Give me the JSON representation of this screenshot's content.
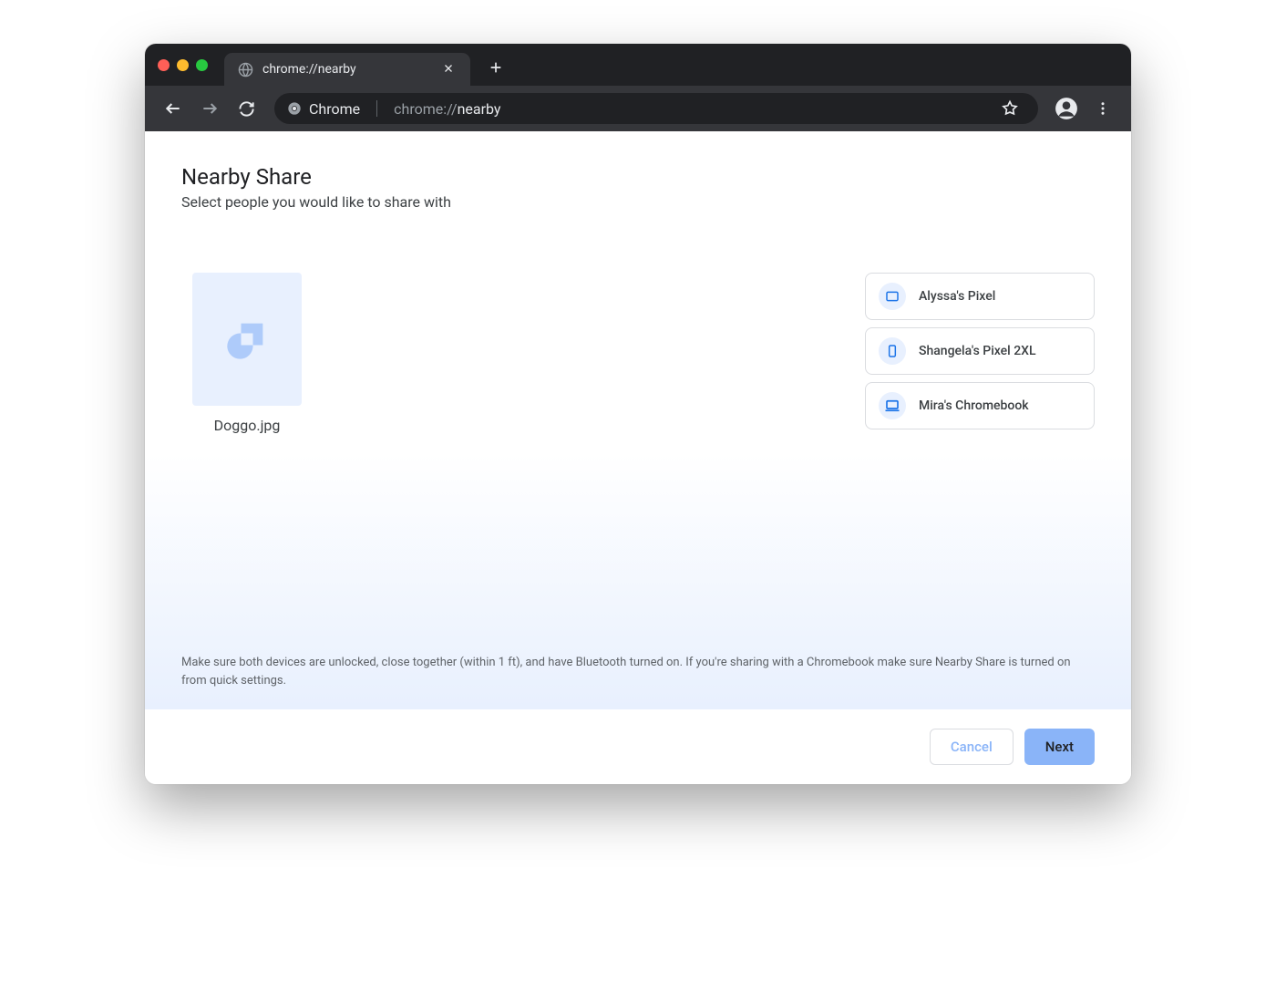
{
  "browser": {
    "tab_title": "chrome://nearby",
    "omnibox": {
      "chip_label": "Chrome",
      "url_scheme": "chrome://",
      "url_path": "nearby"
    }
  },
  "page": {
    "title": "Nearby Share",
    "subtitle": "Select people you would like to share with",
    "file": {
      "name": "Doggo.jpg"
    },
    "devices": [
      {
        "name": "Alyssa's Pixel",
        "icon": "tablet"
      },
      {
        "name": "Shangela's Pixel 2XL",
        "icon": "phone"
      },
      {
        "name": "Mira's Chromebook",
        "icon": "laptop"
      }
    ],
    "note": "Make sure both devices are unlocked, close together (within 1 ft), and have Bluetooth turned on. If you're sharing with a Chromebook make sure Nearby Share is turned on from quick settings.",
    "buttons": {
      "cancel": "Cancel",
      "next": "Next"
    }
  }
}
